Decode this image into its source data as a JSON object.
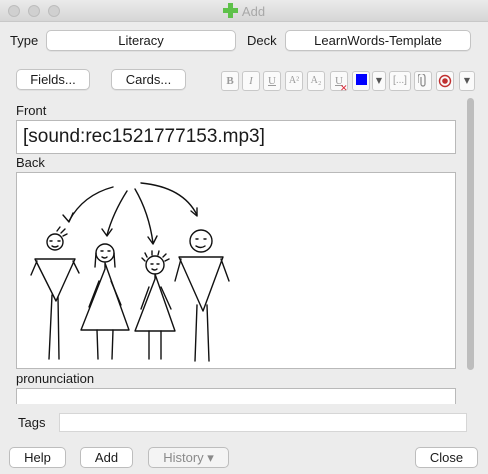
{
  "window": {
    "title": "Add"
  },
  "header": {
    "type_label": "Type",
    "type_value": "Literacy",
    "deck_label": "Deck",
    "deck_value": "LearnWords-Template"
  },
  "toolbar": {
    "fields_label": "Fields...",
    "cards_label": "Cards...",
    "bold": "B",
    "italic": "I",
    "underline": "U",
    "superscript": "A²",
    "subscript": "A₂",
    "clear_format": "U",
    "text_color": "#0000ff",
    "cloze": "[...]",
    "icons": [
      "bold-icon",
      "italic-icon",
      "underline-icon",
      "superscript-icon",
      "subscript-icon",
      "clear-formatting-icon",
      "text-color-icon",
      "color-dropdown-icon",
      "cloze-icon",
      "attach-icon",
      "record-icon",
      "more-dropdown-icon"
    ]
  },
  "fields": {
    "front_label": "Front",
    "front_value": "[sound:rec1521777153.mp3]",
    "back_label": "Back",
    "pronunciation_label": "pronunciation"
  },
  "tags": {
    "label": "Tags",
    "value": ""
  },
  "footer": {
    "help_label": "Help",
    "add_label": "Add",
    "history_label": "History ▾",
    "close_label": "Close"
  }
}
